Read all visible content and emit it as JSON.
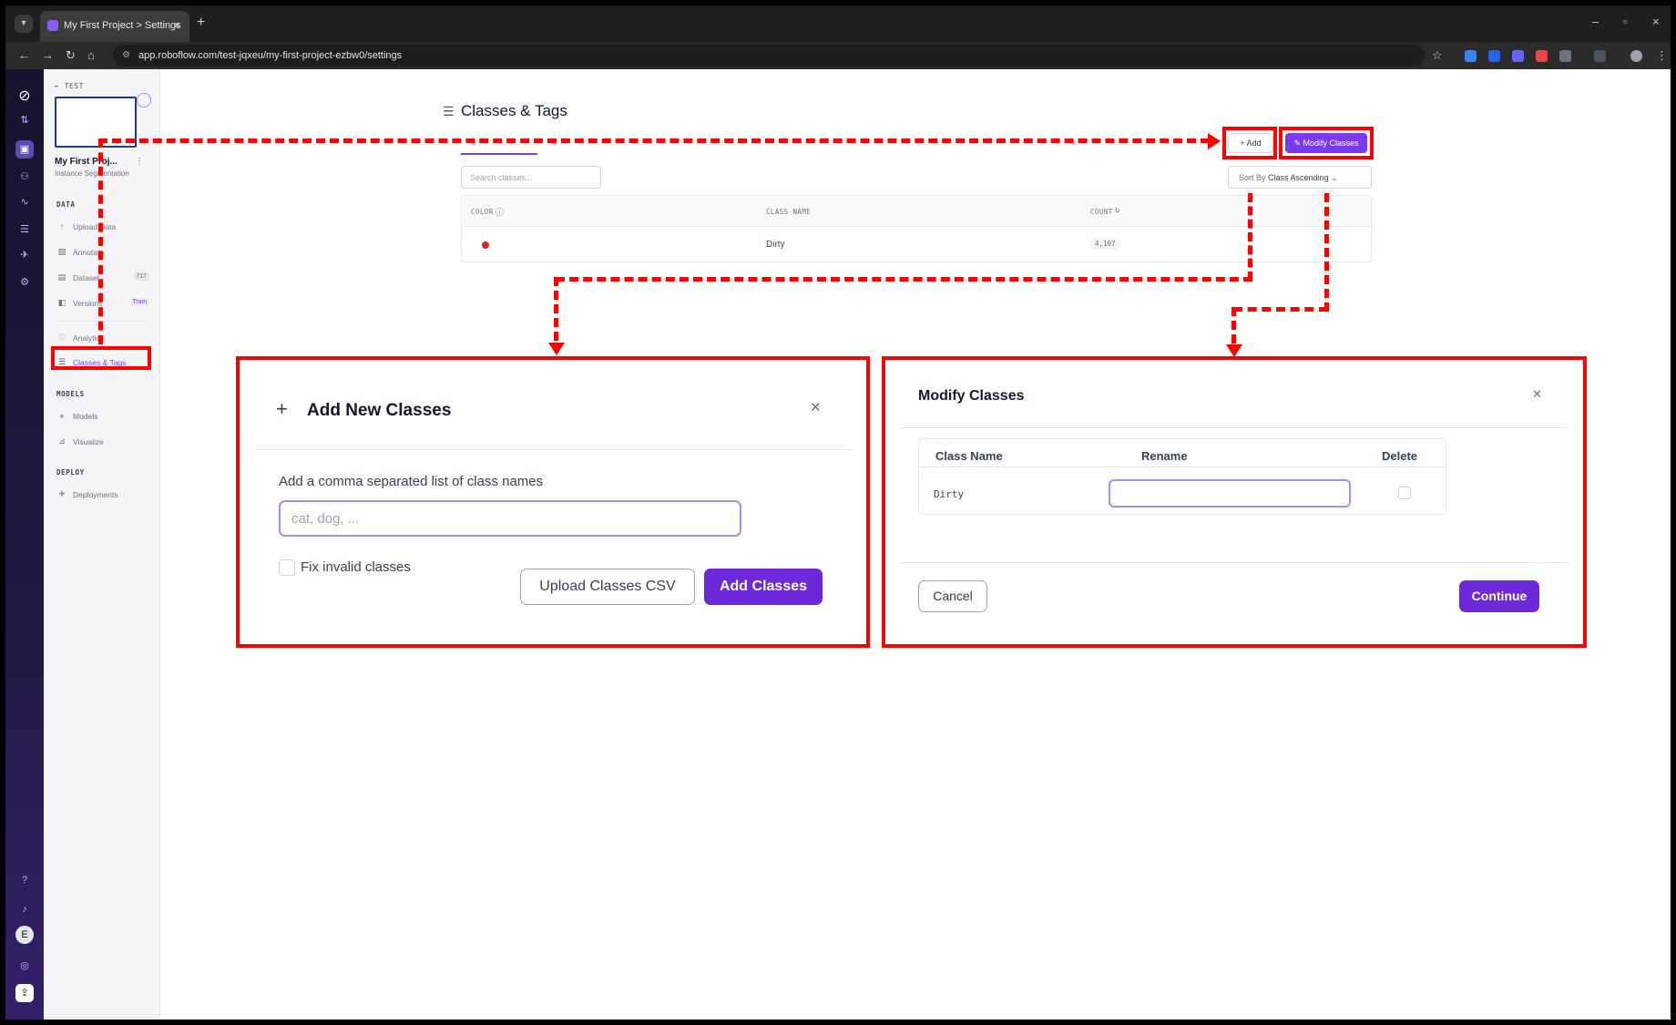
{
  "browser": {
    "tab_title": "My First Project > Settings",
    "url": "app.roboflow.com/test-jqxeu/my-first-project-ezbw0/settings"
  },
  "sidebar": {
    "back_label": "TEST",
    "project_name": "My First Proj...",
    "project_type": "Instance Segmentation",
    "sections": {
      "data": "DATA",
      "models": "MODELS",
      "deploy": "DEPLOY"
    },
    "items": {
      "upload": "Upload Data",
      "annotate": "Annotate",
      "dataset": "Dataset",
      "dataset_count": "717",
      "versions": "Versions",
      "versions_badge": "Train",
      "analytics": "Analytics",
      "classes": "Classes & Tags",
      "models": "Models",
      "visualize": "Visualize",
      "deployments": "Deployments"
    }
  },
  "main": {
    "title": "Classes & Tags",
    "add_label": "+ Add",
    "modify_label": "Modify Classes",
    "search_placeholder": "Search classes...",
    "sort_prefix": "Sort By",
    "sort_value": "Class Ascending",
    "table": {
      "headers": [
        "COLOR",
        "CLASS NAME",
        "COUNT"
      ],
      "rows": [
        {
          "color": "#dc2626",
          "name": "Dirty",
          "count": "4,107"
        }
      ]
    }
  },
  "add_dialog": {
    "title": "Add New Classes",
    "label": "Add a comma separated list of class names",
    "placeholder": "cat, dog, ...",
    "fix_label": "Fix invalid classes",
    "upload_label": "Upload Classes CSV",
    "submit_label": "Add Classes"
  },
  "modify_dialog": {
    "title": "Modify Classes",
    "headers": [
      "Class Name",
      "Rename",
      "Delete"
    ],
    "row_name": "Dirty",
    "cancel_label": "Cancel",
    "continue_label": "Continue"
  },
  "colors": {
    "accent": "#7c3aed",
    "annotation": "#ff0000"
  }
}
